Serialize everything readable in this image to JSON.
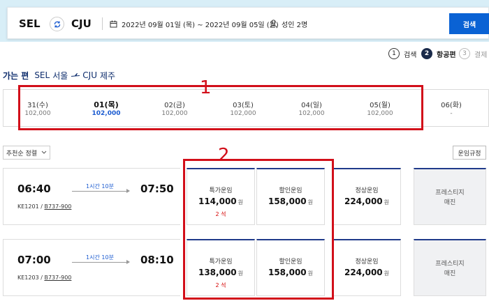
{
  "search": {
    "origin": "SEL",
    "destination": "CJU",
    "dates": "2022년 09월 01일 (목) ~ 2022년 09월 05일 (월)",
    "passengers": "성인 2명",
    "button": "검색"
  },
  "steps": [
    {
      "num": "1",
      "label": "검색",
      "state": "done"
    },
    {
      "num": "2",
      "label": "항공편",
      "state": "active"
    },
    {
      "num": "3",
      "label": "결제",
      "state": "future"
    }
  ],
  "leg": {
    "label": "가는 편",
    "from_code": "SEL",
    "from_city": "서울",
    "to_code": "CJU",
    "to_city": "제주"
  },
  "dates": [
    {
      "date": "31(수)",
      "price": "102,000"
    },
    {
      "date": "01(목)",
      "price": "102,000",
      "selected": true
    },
    {
      "date": "02(금)",
      "price": "102,000"
    },
    {
      "date": "03(토)",
      "price": "102,000"
    },
    {
      "date": "04(일)",
      "price": "102,000"
    },
    {
      "date": "05(월)",
      "price": "102,000"
    },
    {
      "date": "06(화)",
      "price": "-"
    }
  ],
  "sort": {
    "label": "추천순 정렬"
  },
  "fare_rules": "운임규정",
  "annotations": {
    "one": "1",
    "two": "2"
  },
  "flights": [
    {
      "depart": "06:40",
      "duration": "1시간 10분",
      "arrive": "07:50",
      "flight_no": "KE1201",
      "aircraft": "B737-900",
      "fares": [
        {
          "name": "특가운임",
          "price": "114,000",
          "unit": "원",
          "seats": "2 석"
        },
        {
          "name": "할인운임",
          "price": "158,000",
          "unit": "원",
          "seats": ""
        },
        {
          "name": "정상운임",
          "price": "224,000",
          "unit": "원",
          "seats": ""
        }
      ],
      "prestige": {
        "name": "프레스티지",
        "status": "매진"
      }
    },
    {
      "depart": "07:00",
      "duration": "1시간 10분",
      "arrive": "08:10",
      "flight_no": "KE1203",
      "aircraft": "B737-900",
      "fares": [
        {
          "name": "특가운임",
          "price": "138,000",
          "unit": "원",
          "seats": "2 석"
        },
        {
          "name": "할인운임",
          "price": "158,000",
          "unit": "원",
          "seats": ""
        },
        {
          "name": "정상운임",
          "price": "224,000",
          "unit": "원",
          "seats": ""
        }
      ],
      "prestige": {
        "name": "프레스티지",
        "status": "매진"
      }
    }
  ],
  "colors": {
    "accent": "#0a62d4",
    "navy": "#1f3a8a",
    "annotation": "#d20f1a",
    "seats": "#d40000"
  }
}
